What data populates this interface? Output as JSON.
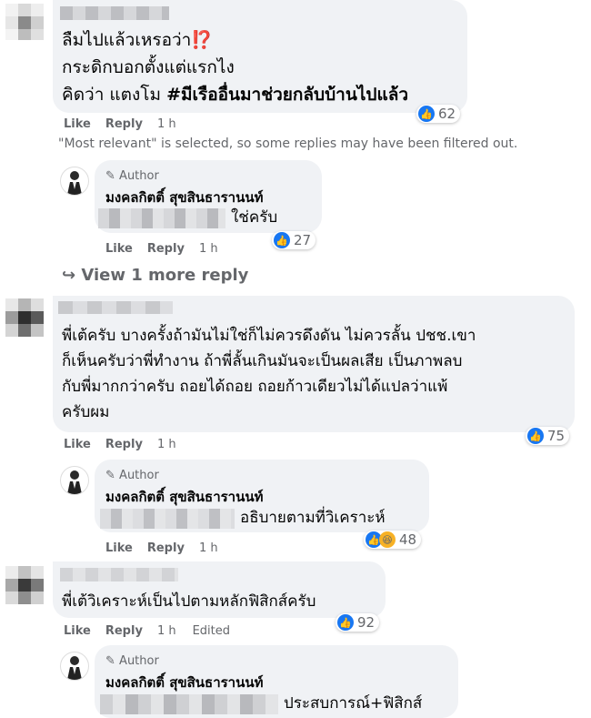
{
  "comments": [
    {
      "lines": [
        "ลืมไปแล้วเหรอว่า⁉️",
        "กระดิกบอกตั้งแต่แรกไง",
        "คิดว่า แตงโม #มีเรืออื่นมาช่วยกลับบ้านไปแล้ว"
      ],
      "line3_plain": "คิดว่า แตงโม ",
      "line3_bold": "#มีเรืออื่นมาช่วยกลับบ้านไปแล้ว",
      "actions": {
        "like": "Like",
        "reply": "Reply",
        "time": "1 h"
      },
      "reaction_count": "62"
    },
    {
      "lines": [
        "พี่เต้ครับ บางครั้งถ้ามันไม่ใช่ก็ไม่ควรดึงดัน ไม่ควรลั้น ปชช.เขา",
        "ก็เห็นครับว่าพี่ทำงาน ถ้าพี่ลั้นเกินมันจะเป็นผลเสีย เป็นภาพลบ",
        "กับพี่มากกว่าครับ ถอยได้ถอย ถอยก้าวเดียวไม่ได้แปลว่าแพ้",
        "ครับผม"
      ],
      "actions": {
        "like": "Like",
        "reply": "Reply",
        "time": "1 h"
      },
      "reaction_count": "75"
    },
    {
      "lines": [
        "พี่เต้วิเคราะห์เป็นไปตามหลักฟิสิกส์ครับ"
      ],
      "actions": {
        "like": "Like",
        "reply": "Reply",
        "time": "1 h",
        "edited": "Edited"
      },
      "reaction_count": "92"
    }
  ],
  "filter_notice": "\"Most relevant\" is selected, so some replies may have been filtered out.",
  "replies": [
    {
      "badge": "Author",
      "name": "มงคลกิตติ์ สุขสินธารานนท์",
      "text": "ใช่ครับ",
      "actions": {
        "like": "Like",
        "reply": "Reply",
        "time": "1 h"
      },
      "reaction_count": "27"
    },
    {
      "badge": "Author",
      "name": "มงคลกิตติ์ สุขสินธารานนท์",
      "text": "อธิบายตามที่วิเคราะห์",
      "actions": {
        "like": "Like",
        "reply": "Reply",
        "time": "1 h"
      },
      "reaction_count": "48"
    },
    {
      "badge": "Author",
      "name": "มงคลกิตติ์ สุขสินธารานนท์",
      "text": "ประสบการณ์+ฟิสิกส์"
    }
  ],
  "view_more": "View 1 more reply",
  "colors": {
    "bubble": "#f0f2f5",
    "meta": "#65676b",
    "like_blue": "#1877f2",
    "haha_yellow": "#f7b125"
  },
  "icons": {
    "pencil": "pencil-icon",
    "reply_arrow": "reply-arrow-icon",
    "like": "like-reaction-icon",
    "haha": "haha-reaction-icon"
  }
}
